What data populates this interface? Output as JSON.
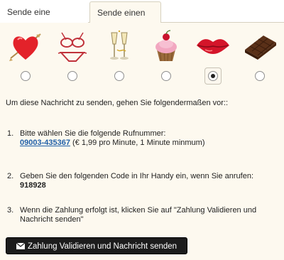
{
  "tabs": {
    "message": "Sende eine Nachricht",
    "flirt": "Sende einen Flirt"
  },
  "flirts": [
    {
      "icon": "heart-arrow-icon",
      "selected": false
    },
    {
      "icon": "lingerie-icon",
      "selected": false
    },
    {
      "icon": "champagne-icon",
      "selected": false
    },
    {
      "icon": "cupcake-icon",
      "selected": false
    },
    {
      "icon": "lips-icon",
      "selected": true
    },
    {
      "icon": "chocolate-icon",
      "selected": false
    }
  ],
  "intro": "Um diese Nachricht zu senden, gehen Sie folgendermaßen vor::",
  "steps": [
    {
      "num": "1.",
      "text_a": "Bitte wählen Sie die folgende Rufnummer:",
      "phone": "09003-435367",
      "text_b": " (€ 1,99 pro Minute, 1 Minute minmum)"
    },
    {
      "num": "2.",
      "text_a": "Geben Sie den folgenden Code in Ihr Handy ein, wenn Sie anrufen: ",
      "code": "918928"
    },
    {
      "num": "3.",
      "text_a": "Wenn die Zahlung erfolgt ist, klicken Sie auf \"Zahlung Validieren und Nachricht senden\""
    }
  ],
  "submit_label": "Zahlung Validieren und Nachricht senden",
  "colors": {
    "panel_bg": "#fdf9ef",
    "link": "#1f5fa8",
    "button_bg": "#1c1c1c"
  }
}
